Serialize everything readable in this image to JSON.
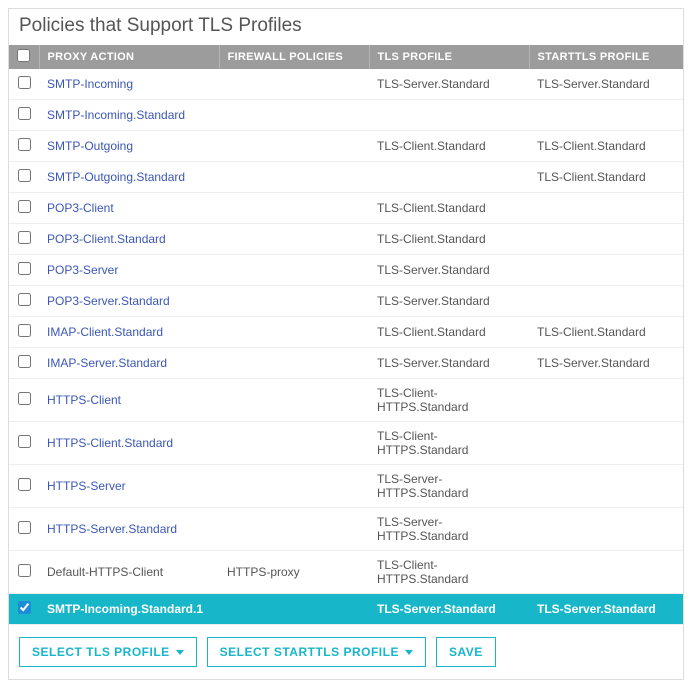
{
  "title": "Policies that Support TLS Profiles",
  "columns": {
    "proxy": "PROXY ACTION",
    "firewall": "FIREWALL POLICIES",
    "tls": "TLS PROFILE",
    "starttls": "STARTTLS PROFILE"
  },
  "rows": [
    {
      "checked": false,
      "selected": false,
      "link": true,
      "proxy": "SMTP-Incoming",
      "firewall": "",
      "tls": "TLS-Server.Standard",
      "starttls": "TLS-Server.Standard"
    },
    {
      "checked": false,
      "selected": false,
      "link": true,
      "proxy": "SMTP-Incoming.Standard",
      "firewall": "",
      "tls": "",
      "starttls": ""
    },
    {
      "checked": false,
      "selected": false,
      "link": true,
      "proxy": "SMTP-Outgoing",
      "firewall": "",
      "tls": "TLS-Client.Standard",
      "starttls": "TLS-Client.Standard"
    },
    {
      "checked": false,
      "selected": false,
      "link": true,
      "proxy": "SMTP-Outgoing.Standard",
      "firewall": "",
      "tls": "",
      "starttls": "TLS-Client.Standard"
    },
    {
      "checked": false,
      "selected": false,
      "link": true,
      "proxy": "POP3-Client",
      "firewall": "",
      "tls": "TLS-Client.Standard",
      "starttls": ""
    },
    {
      "checked": false,
      "selected": false,
      "link": true,
      "proxy": "POP3-Client.Standard",
      "firewall": "",
      "tls": "TLS-Client.Standard",
      "starttls": ""
    },
    {
      "checked": false,
      "selected": false,
      "link": true,
      "proxy": "POP3-Server",
      "firewall": "",
      "tls": "TLS-Server.Standard",
      "starttls": ""
    },
    {
      "checked": false,
      "selected": false,
      "link": true,
      "proxy": "POP3-Server.Standard",
      "firewall": "",
      "tls": "TLS-Server.Standard",
      "starttls": ""
    },
    {
      "checked": false,
      "selected": false,
      "link": true,
      "proxy": "IMAP-Client.Standard",
      "firewall": "",
      "tls": "TLS-Client.Standard",
      "starttls": "TLS-Client.Standard"
    },
    {
      "checked": false,
      "selected": false,
      "link": true,
      "proxy": "IMAP-Server.Standard",
      "firewall": "",
      "tls": "TLS-Server.Standard",
      "starttls": "TLS-Server.Standard"
    },
    {
      "checked": false,
      "selected": false,
      "link": true,
      "proxy": "HTTPS-Client",
      "firewall": "",
      "tls": "TLS-Client-HTTPS.Standard",
      "starttls": ""
    },
    {
      "checked": false,
      "selected": false,
      "link": true,
      "proxy": "HTTPS-Client.Standard",
      "firewall": "",
      "tls": "TLS-Client-HTTPS.Standard",
      "starttls": ""
    },
    {
      "checked": false,
      "selected": false,
      "link": true,
      "proxy": "HTTPS-Server",
      "firewall": "",
      "tls": "TLS-Server-HTTPS.Standard",
      "starttls": ""
    },
    {
      "checked": false,
      "selected": false,
      "link": true,
      "proxy": "HTTPS-Server.Standard",
      "firewall": "",
      "tls": "TLS-Server-HTTPS.Standard",
      "starttls": ""
    },
    {
      "checked": false,
      "selected": false,
      "link": false,
      "proxy": "Default-HTTPS-Client",
      "firewall": "HTTPS-proxy",
      "tls": "TLS-Client-HTTPS.Standard",
      "starttls": ""
    },
    {
      "checked": true,
      "selected": true,
      "link": false,
      "proxy": "SMTP-Incoming.Standard.1",
      "firewall": "",
      "tls": "TLS-Server.Standard",
      "starttls": "TLS-Server.Standard"
    }
  ],
  "buttons": {
    "select_tls": "SELECT TLS PROFILE",
    "select_starttls": "SELECT STARTTLS PROFILE",
    "save": "SAVE"
  }
}
